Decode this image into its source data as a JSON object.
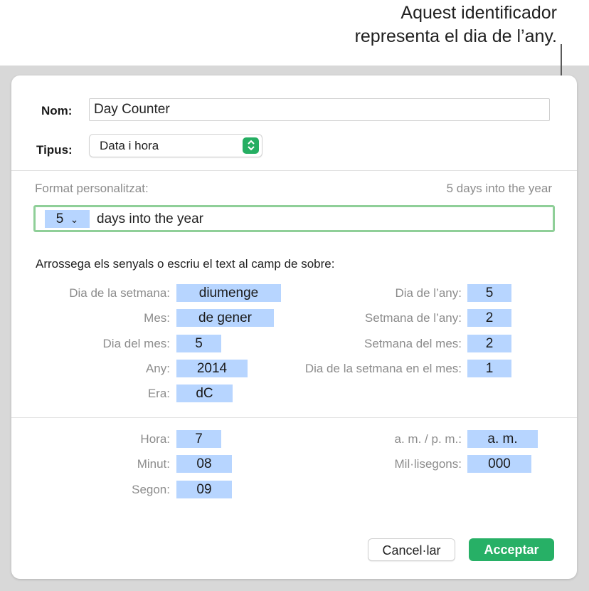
{
  "callout": {
    "line1": "Aquest identificador",
    "line2": "representa el dia de l’any."
  },
  "form": {
    "name_label": "Nom:",
    "name_value": "Day Counter",
    "type_label": "Tipus:",
    "type_value": "Data i hora",
    "custom_format_label": "Format personalitzat:",
    "format_preview": "5 days into the year",
    "format_token": "5",
    "format_token_chevron": "⌄",
    "format_text": "days into the year",
    "instructions": "Arrossega els senyals o escriu el text al camp de sobre:"
  },
  "date_tokens_left": [
    {
      "label": "Dia de la setmana:",
      "value": "diumenge"
    },
    {
      "label": "Mes:",
      "value": "de gener"
    },
    {
      "label": "Dia del mes:",
      "value": "5"
    },
    {
      "label": "Any:",
      "value": "2014"
    },
    {
      "label": "Era:",
      "value": "dC"
    }
  ],
  "date_tokens_right": [
    {
      "label": "Dia de l’any:",
      "value": "5"
    },
    {
      "label": "Setmana de l’any:",
      "value": "2"
    },
    {
      "label": "Setmana del mes:",
      "value": "2"
    },
    {
      "label": "Dia de la setmana en el mes:",
      "value": "1"
    }
  ],
  "time_tokens_left": [
    {
      "label": "Hora:",
      "value": "7"
    },
    {
      "label": "Minut:",
      "value": "08"
    },
    {
      "label": "Segon:",
      "value": "09"
    }
  ],
  "time_tokens_right": [
    {
      "label": "a. m. / p. m.:",
      "value": "a. m."
    },
    {
      "label": "Mil·lisegons:",
      "value": "000"
    }
  ],
  "buttons": {
    "cancel": "Cancel·lar",
    "accept": "Acceptar"
  },
  "colors": {
    "accent_green": "#27b066",
    "token_blue": "#b7d5ff",
    "focus_ring": "#8fcf98"
  }
}
